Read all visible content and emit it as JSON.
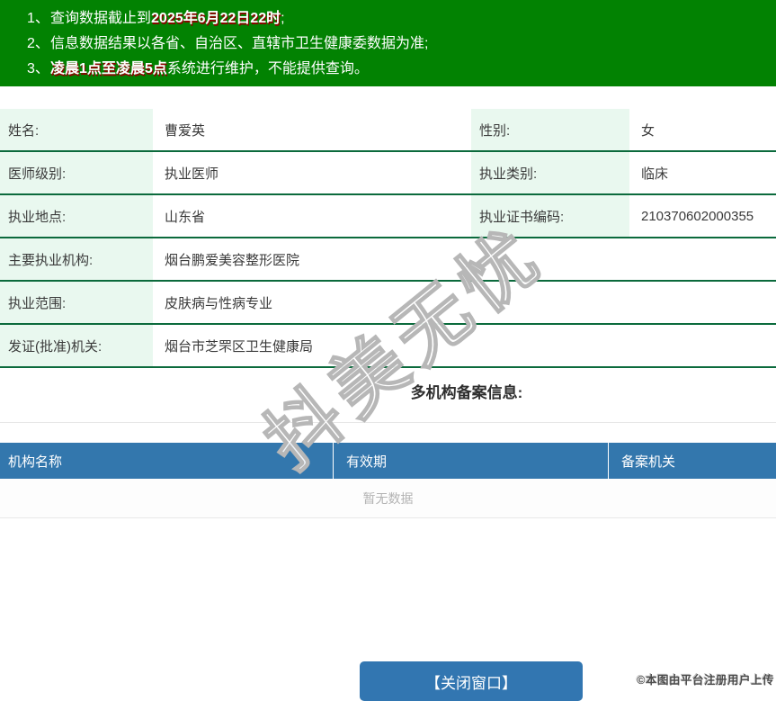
{
  "notice_banner": {
    "bg_color": "#028202",
    "items": [
      {
        "num": "1、",
        "pre": "查询数据截止到",
        "strong": "2025年6月22日22时",
        "post": ";"
      },
      {
        "num": "2、",
        "pre": "信息数据结果以各省、自治区、直辖市卫生健康委数据为准;",
        "strong": "",
        "post": ""
      },
      {
        "num": "3、",
        "pre": "",
        "strong": "凌晨1点至凌晨5点",
        "post": "系统进行维护，不能提供查询。"
      }
    ]
  },
  "doctor_info": {
    "rows": [
      {
        "label1": "姓名:",
        "value1": "曹爱英",
        "label2": "性别:",
        "value2": "女"
      },
      {
        "label1": "医师级别:",
        "value1": "执业医师",
        "label2": "执业类别:",
        "value2": "临床"
      },
      {
        "label1": "执业地点:",
        "value1": "山东省",
        "label2": "执业证书编码:",
        "value2": "210370602000355"
      },
      {
        "label1": "主要执业机构:",
        "value1": "烟台鹏爱美容整形医院"
      },
      {
        "label1": "执业范围:",
        "value1": "皮肤病与性病专业"
      },
      {
        "label1": "发证(批准)机关:",
        "value1": "烟台市芝罘区卫生健康局"
      }
    ]
  },
  "multi_org_section": {
    "title": "多机构备案信息:",
    "table": {
      "headers": [
        "机构名称",
        "有效期",
        "备案机关"
      ],
      "empty_text": "暂无数据",
      "header_bg": "#3377ad"
    }
  },
  "footer": {
    "close_button_label": "【关闭窗口】",
    "copyright": "©本图由平台注册用户上传"
  },
  "watermark_text": "抖美无忧",
  "colors": {
    "banner_bg": "#028202",
    "row_separator": "#0b6a3c",
    "label_bg": "#e9f8ef",
    "table_header_bg": "#3377ad",
    "button_bg": "#3276b1",
    "strong_text_shadow": "#8f0000"
  }
}
